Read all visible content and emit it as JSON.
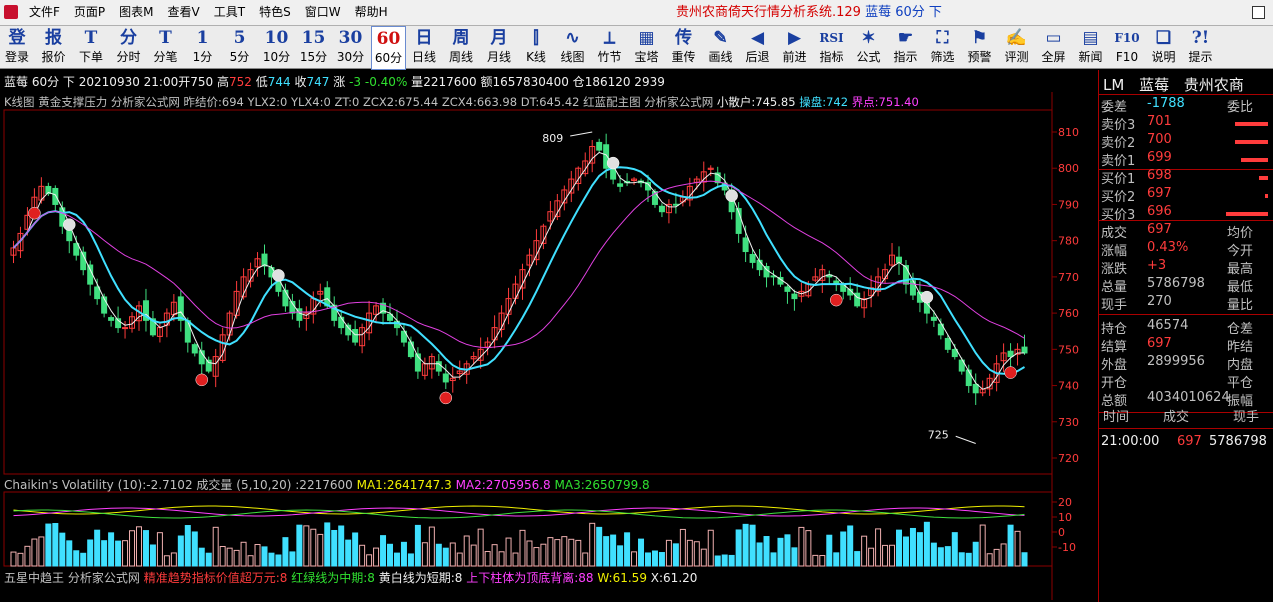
{
  "menu": {
    "items": [
      "文件F",
      "页面P",
      "图表M",
      "查看V",
      "工具T",
      "特色S",
      "窗口W",
      "帮助H"
    ],
    "title": "贵州农商倚天行情分析系统.129",
    "title_sub": "蓝莓 60分 下"
  },
  "toolbar": {
    "buttons": [
      {
        "icon": "登",
        "label": "登录",
        "icon_name": "login-icon"
      },
      {
        "icon": "报",
        "label": "报价",
        "icon_name": "quote-icon"
      },
      {
        "icon": "T",
        "label": "下单",
        "icon_name": "order-icon"
      },
      {
        "icon": "分",
        "label": "分时",
        "icon_name": "intraday-icon"
      },
      {
        "icon": "T",
        "label": "分笔",
        "icon_name": "tick-icon"
      },
      {
        "icon": "1",
        "label": "1分"
      },
      {
        "icon": "5",
        "label": "5分"
      },
      {
        "icon": "10",
        "label": "10分"
      },
      {
        "icon": "15",
        "label": "15分"
      },
      {
        "icon": "30",
        "label": "30分"
      },
      {
        "icon": "60",
        "label": "60分",
        "active": true
      },
      {
        "icon": "日",
        "label": "日线"
      },
      {
        "icon": "周",
        "label": "周线"
      },
      {
        "icon": "月",
        "label": "月线"
      },
      {
        "icon": "⫿",
        "label": "K线",
        "icon_name": "kline-icon"
      },
      {
        "icon": "∿",
        "label": "线图",
        "icon_name": "linechart-icon"
      },
      {
        "icon": "⟂",
        "label": "竹节",
        "icon_name": "bamboo-icon"
      },
      {
        "icon": "▦",
        "label": "宝塔",
        "icon_name": "tower-icon"
      },
      {
        "icon": "传",
        "label": "重传",
        "icon_name": "retransmit-icon"
      },
      {
        "icon": "✎",
        "label": "画线",
        "icon_name": "pencil-icon"
      },
      {
        "icon": "◀",
        "label": "后退",
        "icon_name": "back-icon"
      },
      {
        "icon": "▶",
        "label": "前进",
        "icon_name": "forward-icon"
      },
      {
        "icon": "RSI",
        "label": "指标",
        "icon_name": "indicator-icon"
      },
      {
        "icon": "✶",
        "label": "公式",
        "icon_name": "formula-icon"
      },
      {
        "icon": "☛",
        "label": "指示",
        "icon_name": "pointer-icon"
      },
      {
        "icon": "⛶",
        "label": "筛选",
        "icon_name": "binoculars-icon"
      },
      {
        "icon": "⚑",
        "label": "预警",
        "icon_name": "alert-icon"
      },
      {
        "icon": "✍",
        "label": "评测",
        "icon_name": "evaluate-icon"
      },
      {
        "icon": "▭",
        "label": "全屏",
        "icon_name": "fullscreen-icon"
      },
      {
        "icon": "▤",
        "label": "新闻",
        "icon_name": "news-icon"
      },
      {
        "icon": "F10",
        "label": "F10"
      },
      {
        "icon": "❏",
        "label": "说明",
        "icon_name": "manual-icon"
      },
      {
        "icon": "?!",
        "label": "提示",
        "icon_name": "hint-icon"
      }
    ]
  },
  "info_line": {
    "symbol": "蓝莓",
    "period": "60分 下",
    "datetime": "20210930 21:00",
    "open_label": "开",
    "open": "750",
    "high_label": "高",
    "high": "752",
    "low_label": "低",
    "low": "744",
    "close_label": "收",
    "close": "747",
    "change_label": "涨",
    "change": "-3",
    "change_pct": "-0.40%",
    "volume_label": "量",
    "volume": "2217600",
    "amount_label": "额",
    "amount": "1657830400",
    "oi_label": "仓",
    "oi": "186120 2939"
  },
  "indicator_line": {
    "kline": "K线图",
    "gold": "黄金支撑压力",
    "analyst": "分析家公式网",
    "prev_settle": "昨结价:694",
    "ylx2": "YLX2:0",
    "ylx4": "YLX4:0",
    "zt": "ZT:0",
    "zcx2": "ZCX2:675.44",
    "zcx4": "ZCX4:663.98",
    "dt": "DT:645.42",
    "red_blue": "红蓝配主图",
    "analyst2": "分析家公式网",
    "retail": "小散户:745.85",
    "operator": "操盘:742",
    "boundary": "界点:751.40"
  },
  "sub_indicator_1": {
    "name": "Chaikin's Volatility",
    "param": "(10)",
    "value": ":-2.7102",
    "vol_name": "成交量",
    "vol_param": "(5,10,20)",
    "vol_value": ":2217600",
    "ma1": "MA1:2641747.3",
    "ma2": "MA2:2705956.8",
    "ma3": "MA3:2650799.8"
  },
  "sub_indicator_2": {
    "name": "五星中趋王",
    "analyst": "分析家公式网",
    "t1": "精准趋势指标价值超万元:8",
    "t2": "红绿线为中期:8",
    "t3": "黄白线为短期:8",
    "t4": "上下柱体为顶底背离:88",
    "w": "W:61.59",
    "x": "X:61.20"
  },
  "right_panel": {
    "code": "LM",
    "name": "蓝莓",
    "bank": "贵州农商",
    "weibi_label": "委差",
    "weibi": "-1788",
    "weibi_r": "委比",
    "asks": [
      {
        "label": "卖价3",
        "price": "701",
        "bar": 0.55
      },
      {
        "label": "卖价2",
        "price": "700",
        "bar": 0.55
      },
      {
        "label": "卖价1",
        "price": "699",
        "bar": 0.45
      }
    ],
    "bids": [
      {
        "label": "买价1",
        "price": "698",
        "bar": 0.15
      },
      {
        "label": "买价2",
        "price": "697",
        "bar": 0.05
      },
      {
        "label": "买价3",
        "price": "696",
        "bar": 0.7
      }
    ],
    "stats": [
      {
        "k": "成交",
        "v": "697",
        "c": "red",
        "k2": "均价"
      },
      {
        "k": "涨幅",
        "v": "0.43%",
        "c": "red",
        "k2": "今开"
      },
      {
        "k": "涨跌",
        "v": "+3",
        "c": "red",
        "k2": "最高"
      },
      {
        "k": "总量",
        "v": "5786798",
        "c": "grey",
        "k2": "最低"
      },
      {
        "k": "现手",
        "v": "270",
        "c": "grey",
        "k2": "量比"
      }
    ],
    "stats2": [
      {
        "k": "持仓",
        "v": "46574",
        "c": "grey",
        "k2": "仓差"
      },
      {
        "k": "结算",
        "v": "697",
        "c": "red",
        "k2": "昨结"
      },
      {
        "k": "外盘",
        "v": "2899956",
        "c": "grey",
        "k2": "内盘"
      },
      {
        "k": "开仓",
        "v": "",
        "c": "grey",
        "k2": "平仓"
      },
      {
        "k": "总额",
        "v": "4034010624",
        "c": "grey",
        "k2": "振幅"
      }
    ],
    "tick_head": [
      "时间",
      "成交",
      "现手"
    ],
    "tick_row": {
      "time": "21:00:00",
      "price": "697",
      "vol": "5786798"
    }
  },
  "chart_data": {
    "type": "candlestick",
    "y_axis": {
      "min": 720,
      "max": 810,
      "ticks": [
        810,
        800,
        790,
        780,
        770,
        760,
        750,
        740,
        730,
        720
      ]
    },
    "annotations": [
      {
        "text": "809"
      },
      {
        "text": "725"
      }
    ],
    "colors": {
      "up": "#ff3c3c",
      "down": "#40e080",
      "ma_short": "#40e0ff",
      "ma_long": "#e040e0",
      "line_white": "#f0f0f0",
      "vol_up": "#40e0ff",
      "vol_down": "#f0b0b0",
      "grid": "#8b0000"
    },
    "closes": [
      778,
      782,
      787,
      792,
      795,
      793,
      790,
      784,
      780,
      776,
      772,
      768,
      764,
      760,
      758,
      756,
      756,
      759,
      762,
      758,
      754,
      756,
      760,
      763,
      758,
      752,
      749,
      746,
      744,
      748,
      754,
      760,
      766,
      770,
      772,
      775,
      773,
      770,
      766,
      762,
      760,
      758,
      760,
      764,
      766,
      762,
      758,
      756,
      754,
      752,
      756,
      760,
      762,
      760,
      758,
      756,
      752,
      748,
      744,
      746,
      748,
      744,
      741,
      742,
      744,
      746,
      748,
      750,
      752,
      756,
      760,
      764,
      768,
      772,
      776,
      780,
      784,
      788,
      791,
      794,
      797,
      800,
      802,
      806,
      805,
      800,
      797,
      795,
      796,
      797,
      796,
      794,
      790,
      788,
      790,
      790,
      792,
      795,
      797,
      799,
      800,
      796,
      794,
      788,
      782,
      777,
      774,
      772,
      770,
      770,
      768,
      766,
      764,
      766,
      768,
      770,
      772,
      770,
      768,
      766,
      765,
      762,
      764,
      767,
      770,
      772,
      776,
      774,
      768,
      765,
      763,
      760,
      758,
      754,
      750,
      748,
      744,
      740,
      738,
      739,
      742,
      746,
      749,
      748,
      750,
      749
    ]
  },
  "volume_data": {
    "y_ticks": [
      20,
      10,
      0,
      -10
    ]
  }
}
